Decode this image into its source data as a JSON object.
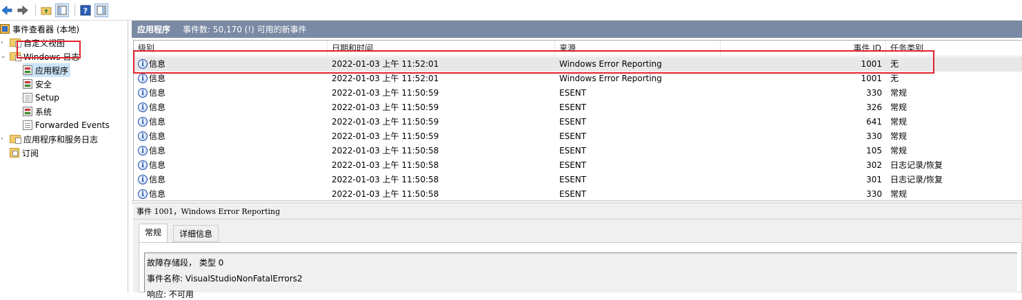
{
  "toolbar": {
    "buttons": [
      "back-arrow-icon",
      "forward-arrow-icon",
      "up-folder-icon",
      "show-hide-tree-icon",
      "help-icon",
      "action-pane-icon"
    ]
  },
  "tree": {
    "root": "事件查看器 (本地)",
    "custom_views": "自定义视图",
    "windows_logs": "Windows 日志",
    "application": "应用程序",
    "security": "安全",
    "setup": "Setup",
    "system": "系统",
    "forwarded": "Forwarded Events",
    "app_service_logs": "应用程序和服务日志",
    "subscriptions": "订阅"
  },
  "header": {
    "title": "应用程序",
    "summary": "事件数: 50,170 (!) 可用的新事件"
  },
  "grid": {
    "columns": [
      "级别",
      "日期和时间",
      "来源",
      "事件 ID",
      "任务类别"
    ],
    "rows": [
      {
        "level": "信息",
        "datetime": "2022-01-03 上午 11:52:01",
        "source": "Windows Error Reporting",
        "id": "1001",
        "category": "无"
      },
      {
        "level": "信息",
        "datetime": "2022-01-03 上午 11:52:01",
        "source": "Windows Error Reporting",
        "id": "1001",
        "category": "无"
      },
      {
        "level": "信息",
        "datetime": "2022-01-03 上午 11:50:59",
        "source": "ESENT",
        "id": "330",
        "category": "常规"
      },
      {
        "level": "信息",
        "datetime": "2022-01-03 上午 11:50:59",
        "source": "ESENT",
        "id": "326",
        "category": "常规"
      },
      {
        "level": "信息",
        "datetime": "2022-01-03 上午 11:50:59",
        "source": "ESENT",
        "id": "641",
        "category": "常规"
      },
      {
        "level": "信息",
        "datetime": "2022-01-03 上午 11:50:59",
        "source": "ESENT",
        "id": "330",
        "category": "常规"
      },
      {
        "level": "信息",
        "datetime": "2022-01-03 上午 11:50:58",
        "source": "ESENT",
        "id": "105",
        "category": "常规"
      },
      {
        "level": "信息",
        "datetime": "2022-01-03 上午 11:50:58",
        "source": "ESENT",
        "id": "302",
        "category": "日志记录/恢复"
      },
      {
        "level": "信息",
        "datetime": "2022-01-03 上午 11:50:58",
        "source": "ESENT",
        "id": "301",
        "category": "日志记录/恢复"
      },
      {
        "level": "信息",
        "datetime": "2022-01-03 上午 11:50:58",
        "source": "ESENT",
        "id": "330",
        "category": "常规"
      }
    ]
  },
  "details": {
    "title": "事件 1001，Windows Error Reporting",
    "tabs": [
      "常规",
      "详细信息"
    ],
    "lines": [
      "故障存储段， 类型 0",
      "事件名称: VisualStudioNonFatalErrors2",
      "响应: 不可用"
    ]
  },
  "colors": {
    "header_bg": "#7a8aa4",
    "highlight_border": "#e0212a",
    "selected_row": "#e8e8e8"
  }
}
